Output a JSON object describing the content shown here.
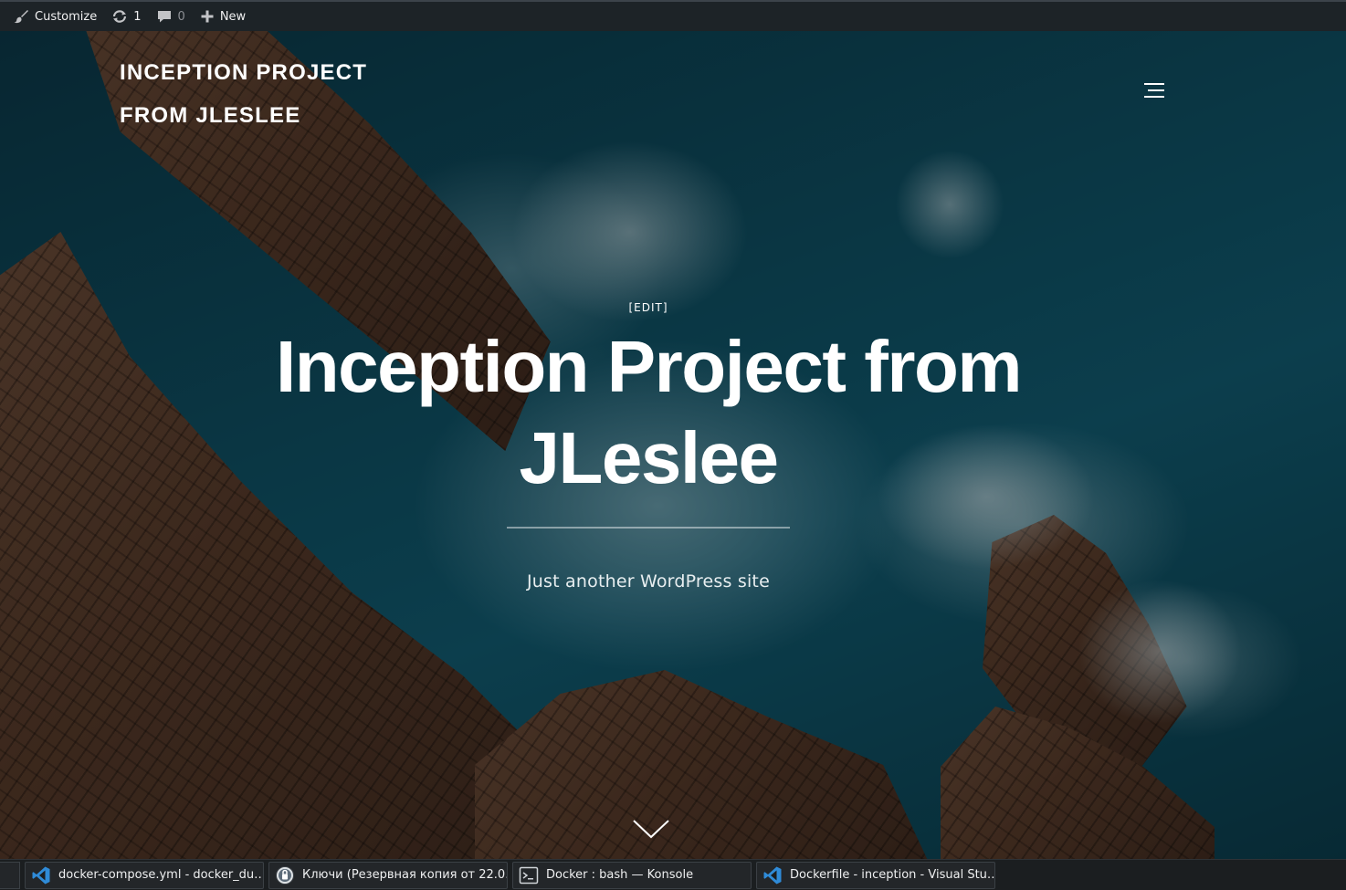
{
  "admin_bar": {
    "customize_label": "Customize",
    "updates_count": "1",
    "comments_count": "0",
    "new_label": "New",
    "icons": [
      "brush-icon",
      "updates-icon",
      "comment-icon",
      "plus-icon"
    ]
  },
  "site": {
    "title_line1": "INCEPTION PROJECT",
    "title_line2": "FROM JLESLEE",
    "edit_label": "[EDIT]",
    "hero_title_line1": "Inception Project from",
    "hero_title_line2": "JLeslee",
    "tagline": "Just another WordPress site"
  },
  "taskbar": {
    "tasks": [
      {
        "label": "docker-compose.yml - docker_du…",
        "icon": "vscode-icon"
      },
      {
        "label": "Ключи (Резервная копия от 22.0…",
        "icon": "keys-icon"
      },
      {
        "label": "Docker : bash — Konsole",
        "icon": "terminal-icon"
      },
      {
        "label": "Dockerfile - inception - Visual Stu…",
        "icon": "vscode-icon"
      }
    ]
  },
  "colors": {
    "admin_bar_bg": "#1d2327",
    "taskbar_bg": "#1b1e20",
    "vscode_blue": "#2f8bd8",
    "hero_text": "#ffffff"
  }
}
